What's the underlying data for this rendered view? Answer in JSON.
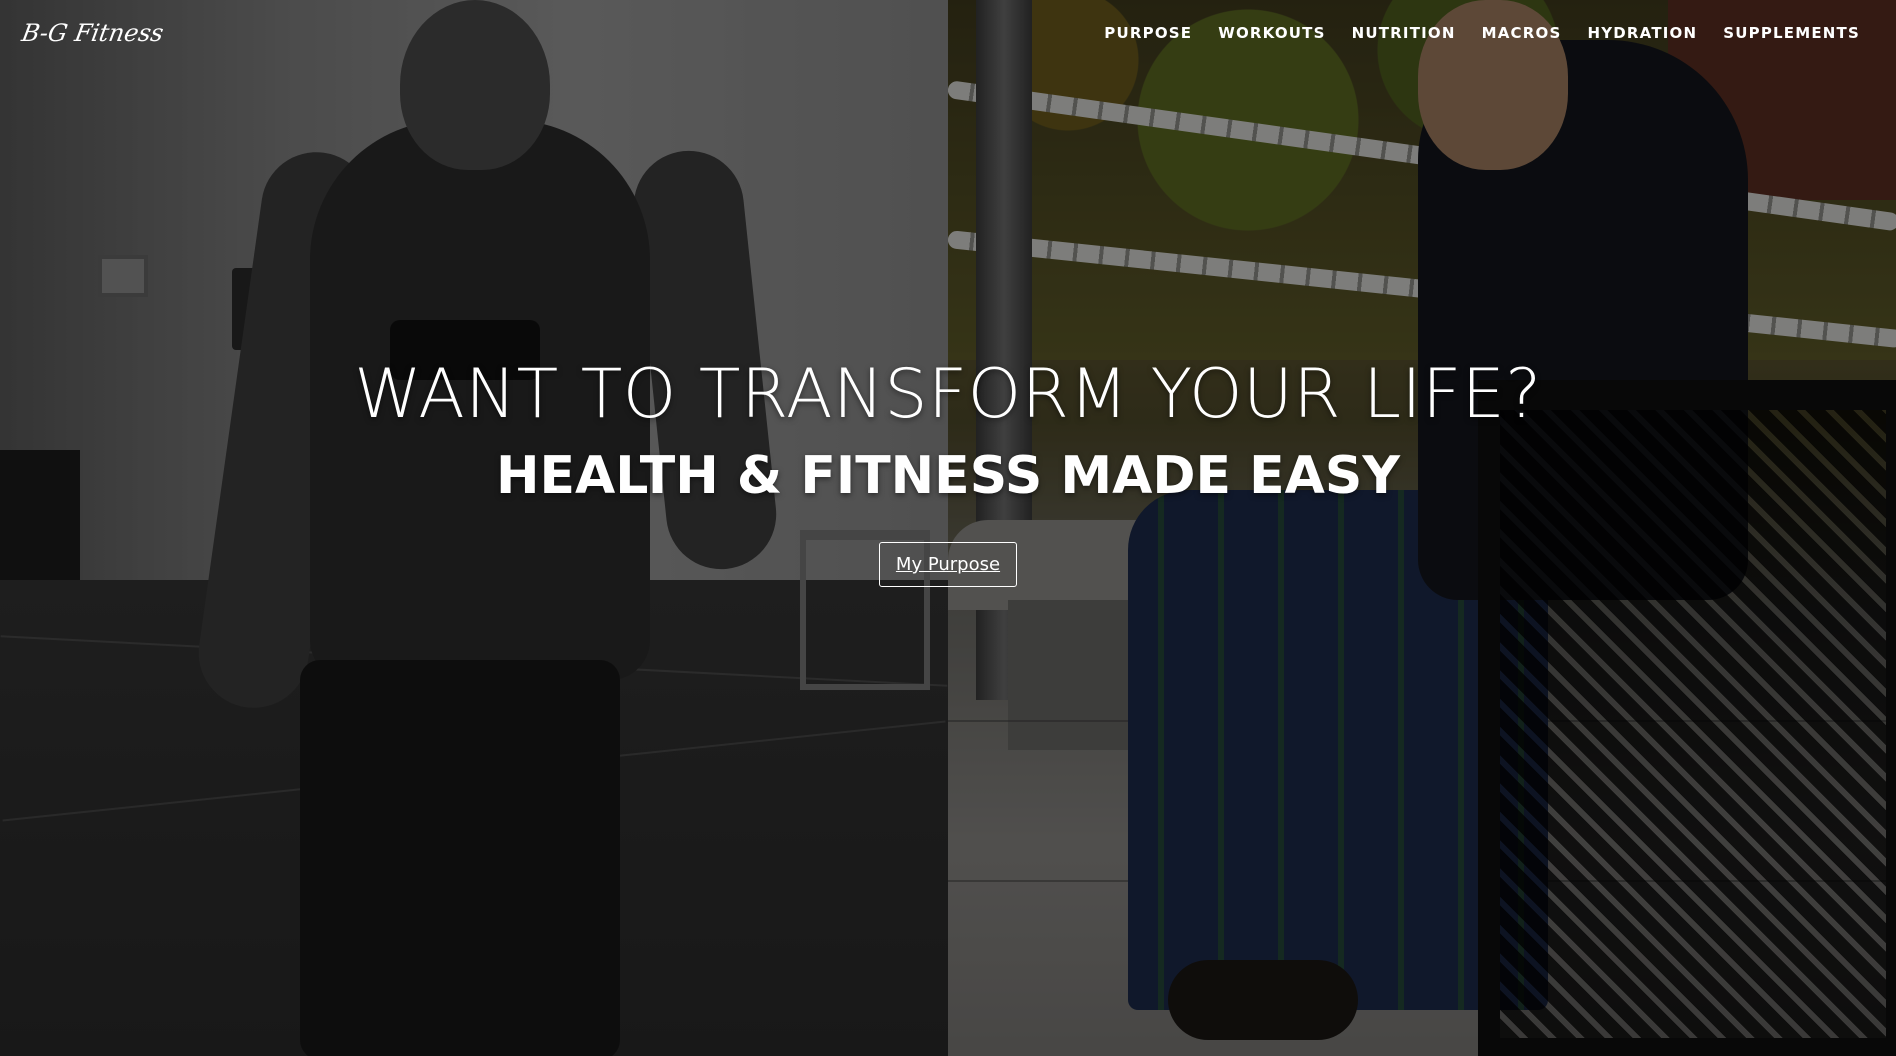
{
  "brand": {
    "logo_text": "B-G Fitness"
  },
  "nav": {
    "items": [
      {
        "label": "PURPOSE"
      },
      {
        "label": "WORKOUTS"
      },
      {
        "label": "NUTRITION"
      },
      {
        "label": "MACROS"
      },
      {
        "label": "HYDRATION"
      },
      {
        "label": "SUPPLEMENTS"
      }
    ]
  },
  "hero": {
    "headline": "WANT TO TRANSFORM YOUR LIFE?",
    "subheadline": "HEALTH & FITNESS MADE EASY",
    "cta_label": "My Purpose"
  }
}
